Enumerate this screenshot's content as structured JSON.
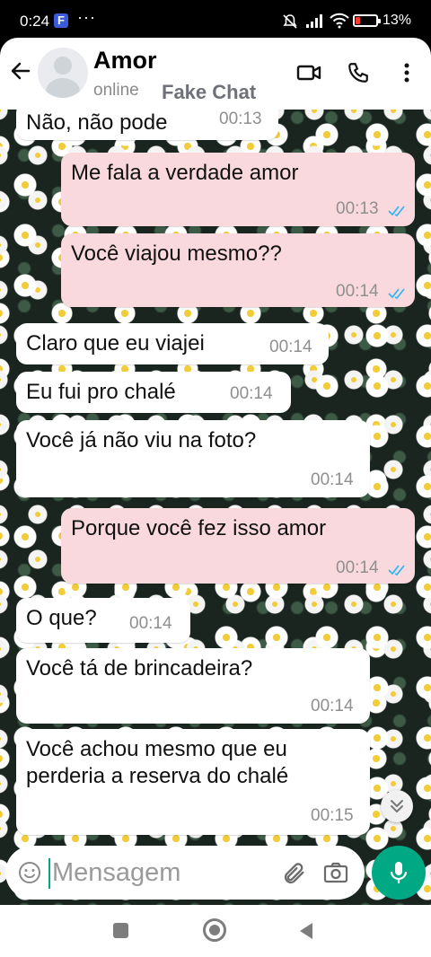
{
  "status_bar": {
    "time": "0:24",
    "notif_icon": "F",
    "more": "···",
    "battery_pct": "13%",
    "battery_color": "#ff3b30"
  },
  "header": {
    "contact_name": "Amor",
    "status": "online",
    "watermark": "Fake Chat"
  },
  "colors": {
    "incoming_bubble": "#ffffff",
    "outgoing_bubble": "#f9d9de",
    "accent": "#00a884",
    "read_ticks": "#34b7f1"
  },
  "messages": [
    {
      "dir": "in",
      "text": "Não, não pode",
      "time": "00:13"
    },
    {
      "dir": "out",
      "text": "Me fala a verdade amor",
      "time": "00:13",
      "read": true
    },
    {
      "dir": "out",
      "text": "Você viajou mesmo??",
      "time": "00:14",
      "read": true
    },
    {
      "dir": "in",
      "text": "Claro que eu viajei",
      "time": "00:14"
    },
    {
      "dir": "in",
      "text": "Eu fui pro chalé",
      "time": "00:14"
    },
    {
      "dir": "in",
      "text": "Você já não viu na foto?",
      "time": "00:14"
    },
    {
      "dir": "out",
      "text": "Porque você fez isso amor",
      "time": "00:14",
      "read": true
    },
    {
      "dir": "in",
      "text": "O que?",
      "time": "00:14"
    },
    {
      "dir": "in",
      "text": "Você tá de brincadeira?",
      "time": "00:14"
    },
    {
      "dir": "in",
      "text": "Você achou mesmo que eu\nperderia a reserva do chalé",
      "time": "00:15"
    }
  ],
  "composer": {
    "placeholder": "Mensagem"
  }
}
